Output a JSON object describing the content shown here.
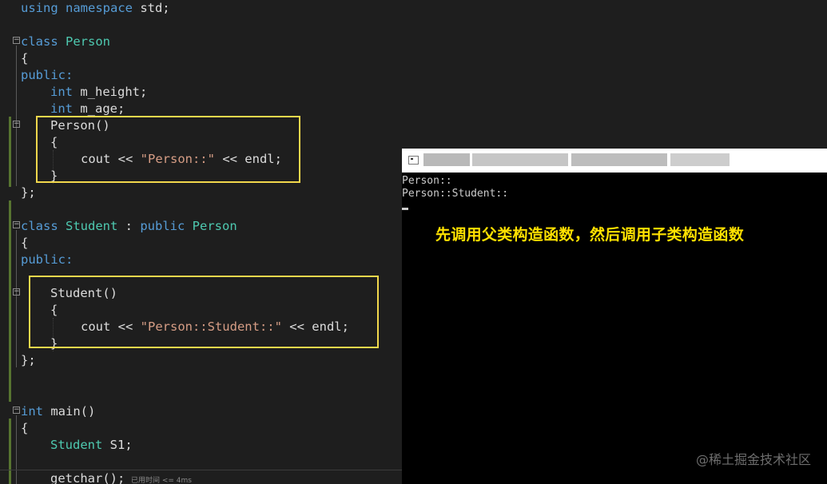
{
  "editor": {
    "lines": {
      "l1_kw": "using namespace",
      "l1_rest": " std;",
      "l2_kw": "class",
      "l2_name": " Person",
      "l3": "{",
      "l4": "public:",
      "l5_kw": "int",
      "l5_rest": " m_height;",
      "l6_kw": "int",
      "l6_rest": " m_age;",
      "l7": "Person()",
      "l8": "{",
      "l9_a": "cout << ",
      "l9_str": "\"Person::\"",
      "l9_b": " << endl;",
      "l10": "}",
      "l11": "};",
      "l12_kw": "class",
      "l12_name": " Student",
      "l12_sep": " : ",
      "l12_kw2": "public",
      "l12_base": " Person",
      "l13": "{",
      "l14": "public:",
      "l15": "Student()",
      "l16": "{",
      "l17_a": "cout << ",
      "l17_str": "\"Person::Student::\"",
      "l17_b": " << endl;",
      "l18": "}",
      "l19": "};",
      "l20_kw": "int",
      "l20_rest": " main()",
      "l21": "{",
      "l22_type": "Student",
      "l22_rest": " S1;",
      "l23": "getchar();"
    },
    "perf_hint": "已用时间 <= 4ms",
    "fold_symbol": "−",
    "highlight_color": "#f2d84c"
  },
  "console": {
    "title": "",
    "output": [
      "Person::",
      "Person::Student::"
    ],
    "annotation": "先调用父类构造函数，然后调用子类构造函数",
    "annotation_color": "#ffe100"
  },
  "watermark": "@稀土掘金技术社区"
}
